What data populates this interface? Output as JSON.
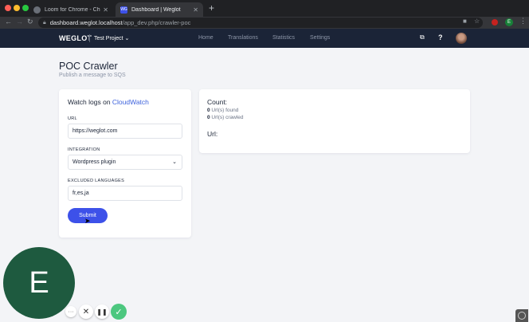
{
  "browser": {
    "tabs": [
      {
        "label": "Loom for Chrome - Chrome We",
        "icon": "loom-icon",
        "active": false
      },
      {
        "label": "Dashboard | Weglot",
        "icon": "weglot-icon",
        "favicon_text": "WG",
        "active": true
      }
    ],
    "url_host": "dashboard.weglot.localhost",
    "url_path": "/app_dev.php/crawler-poc",
    "extension_badge": "E"
  },
  "appnav": {
    "logo": "WEGLOT",
    "project": "Test Project",
    "menu": [
      "Home",
      "Translations",
      "Statistics",
      "Settings"
    ],
    "help": "?"
  },
  "page": {
    "title": "POC Crawler",
    "subtitle": "Publish a message to SQS"
  },
  "form": {
    "heading_prefix": "Watch logs on ",
    "heading_link": "CloudWatch",
    "url_label": "URL",
    "url_value": "https://weglot.com",
    "integration_label": "INTEGRATION",
    "integration_value": "Wordpress plugin",
    "excluded_label": "EXCLUDED LANGUAGES",
    "excluded_value": "fr,es,ja",
    "submit_label": "Submit"
  },
  "results": {
    "count_heading": "Count:",
    "found_count": "0",
    "found_label": " Url(s) found",
    "crawled_count": "0",
    "crawled_label": " Url(s) crawled",
    "url_heading": "Url:"
  },
  "recorder": {
    "avatar_letter": "E",
    "more": "···",
    "cancel": "✕",
    "pause": "❚❚",
    "done": "✓"
  },
  "colors": {
    "nav_bg": "#1b2437",
    "accent": "#3d51e9",
    "link": "#3e63dd",
    "recorder_bubble": "#1e5a3f",
    "recorder_done": "#4cc77f"
  }
}
